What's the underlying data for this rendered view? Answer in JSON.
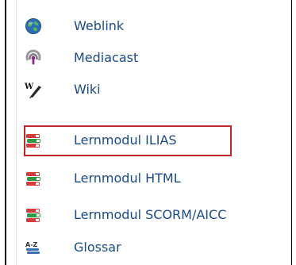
{
  "menu": {
    "items": [
      {
        "label": "Weblink",
        "icon": "globe-icon"
      },
      {
        "label": "Mediacast",
        "icon": "podcast-icon"
      },
      {
        "label": "Wiki",
        "icon": "wiki-pen-icon"
      },
      {
        "label": "Lernmodul ILIAS",
        "icon": "books-stack-icon",
        "highlighted": true
      },
      {
        "label": "Lernmodul HTML",
        "icon": "books-stack-icon"
      },
      {
        "label": "Lernmodul SCORM/AICC",
        "icon": "books-stack-icon"
      },
      {
        "label": "Glossar",
        "icon": "glossary-az-icon"
      }
    ]
  },
  "colors": {
    "link": "#1a4b86",
    "highlight_border": "#c0272d"
  }
}
